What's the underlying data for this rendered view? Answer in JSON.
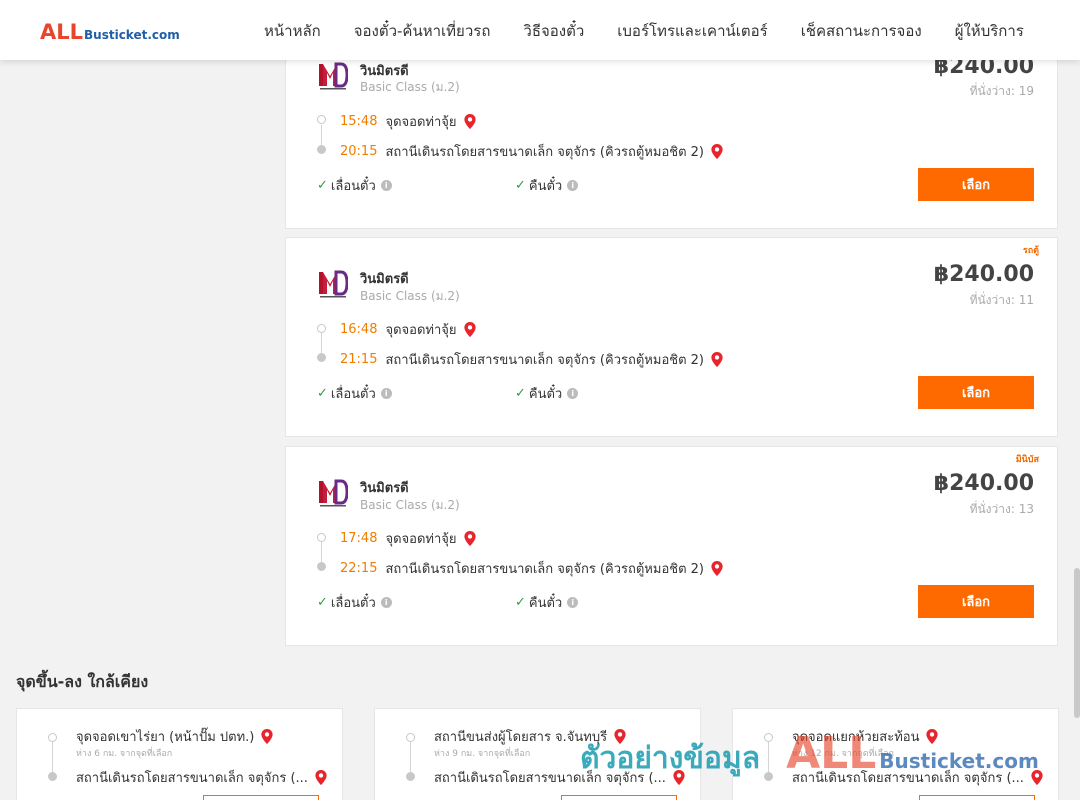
{
  "header": {
    "logo_all": "ALL",
    "logo_rest": "Busticket.com",
    "nav": [
      "หน้าหลัก",
      "จองตั๋ว-ค้นหาเที่ยวรถ",
      "วิธีจองตั๋ว",
      "เบอร์โทรและเคาน์เตอร์",
      "เช็คสถานะการจอง",
      "ผู้ให้บริการ"
    ]
  },
  "trips": [
    {
      "badge": "",
      "operator": "วินมิตรดี",
      "bus_class": "Basic Class (ม.2)",
      "price": "฿240.00",
      "seats": "ที่นั่งว่าง: 19",
      "depart_time": "15:48",
      "depart_place": "จุดจอดท่าจุ้ย",
      "arrive_time": "20:15",
      "arrive_place": "สถานีเดินรถโดยสารขนาดเล็ก จตุจักร (คิวรถตู้หมอชิต 2)",
      "option_reschedule": "เลื่อนตั๋ว",
      "option_refund": "คืนตั๋ว",
      "select_label": "เลือก"
    },
    {
      "badge": "รถตู้",
      "operator": "วินมิตรดี",
      "bus_class": "Basic Class (ม.2)",
      "price": "฿240.00",
      "seats": "ที่นั่งว่าง: 11",
      "depart_time": "16:48",
      "depart_place": "จุดจอดท่าจุ้ย",
      "arrive_time": "21:15",
      "arrive_place": "สถานีเดินรถโดยสารขนาดเล็ก จตุจักร (คิวรถตู้หมอชิต 2)",
      "option_reschedule": "เลื่อนตั๋ว",
      "option_refund": "คืนตั๋ว",
      "select_label": "เลือก"
    },
    {
      "badge": "มินิบัส",
      "operator": "วินมิตรดี",
      "bus_class": "Basic Class (ม.2)",
      "price": "฿240.00",
      "seats": "ที่นั่งว่าง: 13",
      "depart_time": "17:48",
      "depart_place": "จุดจอดท่าจุ้ย",
      "arrive_time": "22:15",
      "arrive_place": "สถานีเดินรถโดยสารขนาดเล็ก จตุจักร (คิวรถตู้หมอชิต 2)",
      "option_reschedule": "เลื่อนตั๋ว",
      "option_refund": "คืนตั๋ว",
      "select_label": "เลือก"
    }
  ],
  "nearby": {
    "title": "จุดขึ้น-ลง ใกล้เคียง",
    "items": [
      {
        "from": "จุดจอดเขาไร่ยา (หน้าปั๊ม ปตท.)",
        "distance": "ห่าง 6 กม. จากจุดที่เลือก",
        "to": "สถานีเดินรถโดยสารขนาดเล็ก จตุจักร (..."
      },
      {
        "from": "สถานีขนส่งผู้โดยสาร จ.จันทบุรี",
        "distance": "ห่าง 9 กม. จากจุดที่เลือก",
        "to": "สถานีเดินรถโดยสารขนาดเล็ก จตุจักร (..."
      },
      {
        "from": "จุดจอดแยกห้วยสะท้อน",
        "distance": "ห่าง 12 กม. จากจุดที่เลือก",
        "to": "สถานีเดินรถโดยสารขนาดเล็ก จตุจักร (..."
      }
    ]
  },
  "watermark": {
    "text": "ตัวอย่างข้อมูล",
    "logo_all": "ALL",
    "logo_rest": "Busticket.com"
  },
  "colors": {
    "accent": "#ff6a00",
    "time": "#f07d00",
    "logo_red": "#e8452c",
    "logo_blue": "#1f5ea8",
    "watermark": "#1a9cb0"
  }
}
